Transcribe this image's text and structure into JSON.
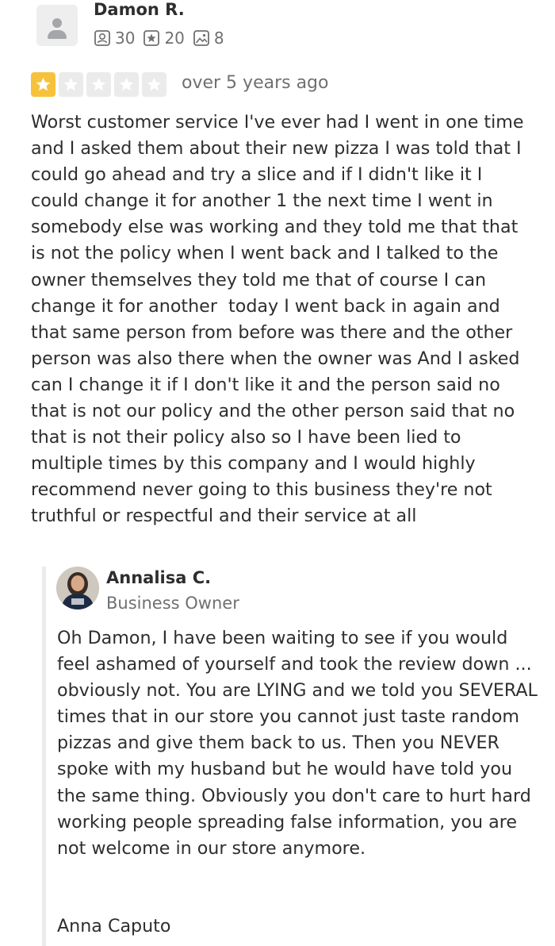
{
  "reviewer": {
    "name": "Damon R.",
    "stats": {
      "friends": "30",
      "reviews": "20",
      "photos": "8"
    }
  },
  "rating": {
    "value": 1,
    "max": 5,
    "filled_color": "#f7c23b",
    "empty_color": "#ebebeb"
  },
  "review": {
    "date": "over 5 years ago",
    "text": "Worst customer service I've ever had I went in one time and I asked them about their new pizza I was told that I could go ahead and try a slice and if I didn't like it I could change it for another 1 the next time I went in somebody else was working and they told me that that is not the policy when I went back and I talked to the owner themselves they told me that of course I can change it for another  today I went back in again and that same person from before was there and the other person was also there when the owner was And I asked can I change it if I don't like it and the person said no that is not our policy and the other person said that no that is not their policy also so I have been lied to multiple times by this company and I would highly recommend never going to this business they're not truthful or respectful and their service at all"
  },
  "owner_reply": {
    "name": "Annalisa C.",
    "role": "Business Owner",
    "text": "Oh Damon, I have been waiting to see if you would feel ashamed of yourself and took the review down ... obviously not. You are LYING and we told you SEVERAL times that in our store you cannot just taste random pizzas and give them back to us. Then you NEVER spoke with my husband but he would have told you the same thing. Obviously you don't care to hurt hard working people spreading false information, you are not welcome in our store anymore.",
    "signature": "Anna Caputo"
  }
}
